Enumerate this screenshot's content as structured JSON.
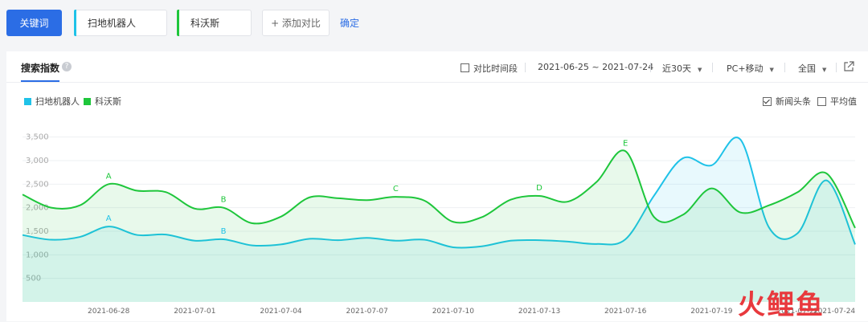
{
  "toolbar": {
    "keyword_btn": "关键词",
    "keyword1": "扫地机器人",
    "keyword2": "科沃斯",
    "add_compare": "+ 添加对比",
    "confirm": "确定"
  },
  "panel": {
    "tab": "搜索指数",
    "help": "?",
    "compare_period": "对比时间段",
    "date_range": "2021-06-25 ~ 2021-07-24",
    "period": "近30天",
    "device": "PC+移动",
    "region": "全国",
    "news": "新闻头条",
    "average": "平均值"
  },
  "colors": {
    "series1": "#1fc2e8",
    "series2": "#1ec63b",
    "accent": "#2b6de5"
  },
  "watermark": "火鲤鱼",
  "chart_data": {
    "type": "line",
    "y_ticks": [
      "3,500",
      "3,000",
      "2,500",
      "2,000",
      "1,500",
      "1,000",
      "500"
    ],
    "y_tick_values": [
      3500,
      3000,
      2500,
      2000,
      1500,
      1000,
      500
    ],
    "ylim": [
      0,
      3750
    ],
    "x_ticks": [
      "2021-06-28",
      "2021-07-01",
      "2021-07-04",
      "2021-07-07",
      "2021-07-10",
      "2021-07-13",
      "2021-07-16",
      "2021-07-19",
      "2021-07-22",
      "2021-07-24"
    ],
    "x_tick_index": [
      3,
      6,
      9,
      12,
      15,
      18,
      21,
      24,
      27,
      29
    ],
    "series": [
      {
        "name": "扫地机器人",
        "color": "#1fc2e8",
        "values": [
          1420,
          1320,
          1380,
          1600,
          1420,
          1430,
          1300,
          1330,
          1200,
          1220,
          1340,
          1310,
          1360,
          1300,
          1320,
          1160,
          1180,
          1300,
          1310,
          1280,
          1230,
          1330,
          2260,
          3050,
          2900,
          3450,
          1580,
          1460,
          2580,
          1220
        ],
        "annotations": [
          {
            "i": 3,
            "label": "A"
          },
          {
            "i": 7,
            "label": "B"
          }
        ]
      },
      {
        "name": "科沃斯",
        "color": "#1ec63b",
        "values": [
          2280,
          2000,
          2050,
          2500,
          2360,
          2330,
          1980,
          2000,
          1670,
          1810,
          2220,
          2200,
          2160,
          2230,
          2150,
          1700,
          1800,
          2170,
          2250,
          2130,
          2550,
          3200,
          1800,
          1850,
          2410,
          1900,
          2050,
          2330,
          2730,
          1570
        ],
        "annotations": [
          {
            "i": 3,
            "label": "A"
          },
          {
            "i": 7,
            "label": "B"
          },
          {
            "i": 13,
            "label": "C"
          },
          {
            "i": 18,
            "label": "D"
          },
          {
            "i": 21,
            "label": "E"
          }
        ]
      }
    ]
  }
}
